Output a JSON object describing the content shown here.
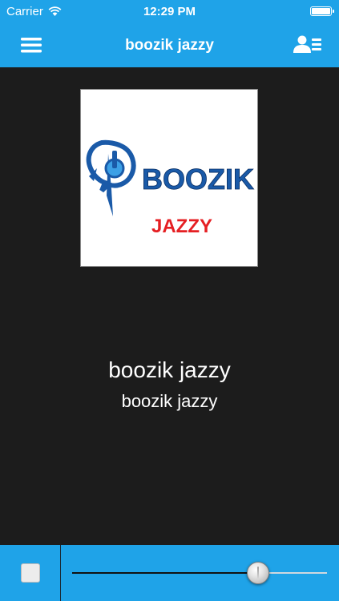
{
  "status_bar": {
    "carrier": "Carrier",
    "time": "12:29 PM",
    "wifi_icon": "wifi-icon",
    "battery_icon": "battery-icon"
  },
  "nav_bar": {
    "title": "boozik jazzy",
    "menu_icon": "hamburger-menu-icon",
    "contacts_icon": "contacts-list-icon"
  },
  "artwork": {
    "logo_text": "BOOZIK",
    "sub_text": "JAZZY",
    "logo_color": "#1a5aa8",
    "sub_text_color": "#e51f23"
  },
  "track": {
    "title": "boozik jazzy",
    "subtitle": "boozik jazzy"
  },
  "player": {
    "stop_icon": "stop-icon",
    "volume": 0.73
  },
  "colors": {
    "accent": "#1fa3e8",
    "background": "#1c1c1c"
  }
}
